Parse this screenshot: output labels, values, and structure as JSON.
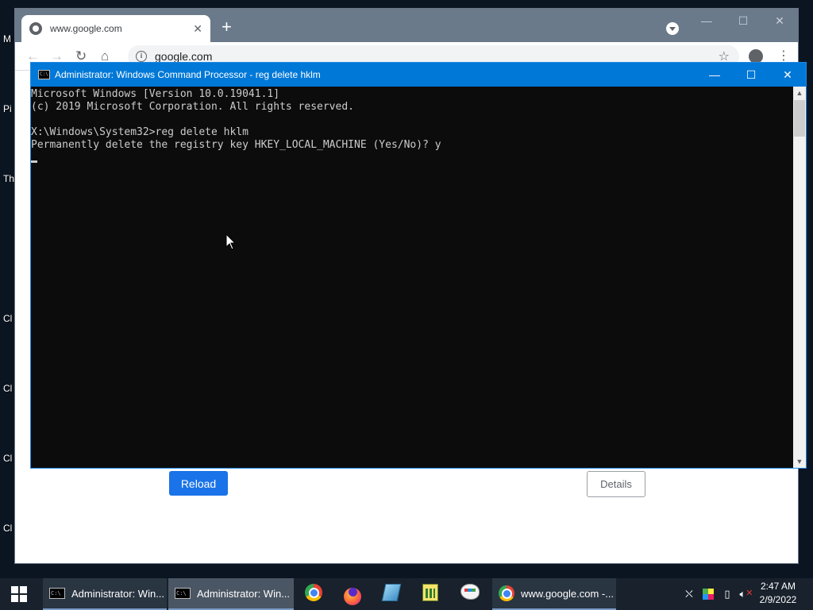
{
  "desktop": {
    "labels": [
      "M",
      "Pi",
      "Th",
      "Cl",
      "Cl",
      "Cl",
      "Cl"
    ]
  },
  "chrome": {
    "tab_title": "www.google.com",
    "tab_close": "✕",
    "new_tab": "+",
    "url": "google.com",
    "reload_label": "Reload",
    "details_label": "Details"
  },
  "cmd": {
    "title": "Administrator: Windows Command Processor - reg  delete hklm",
    "icon_text": "C:\\",
    "lines": [
      "Microsoft Windows [Version 10.0.19041.1]",
      "(c) 2019 Microsoft Corporation. All rights reserved.",
      "",
      "X:\\Windows\\System32>reg delete hklm",
      "Permanently delete the registry key HKEY_LOCAL_MACHINE (Yes/No)? y"
    ]
  },
  "taskbar": {
    "task1_label": "Administrator: Win...",
    "task2_label": "Administrator: Win...",
    "task3_label": "www.google.com -...",
    "time": "2:47 AM",
    "date": "2/9/2022"
  },
  "colors": {
    "cmd_titlebar": "#0078d7",
    "chrome_accent": "#1a73e8",
    "taskbar": "#18212c"
  }
}
